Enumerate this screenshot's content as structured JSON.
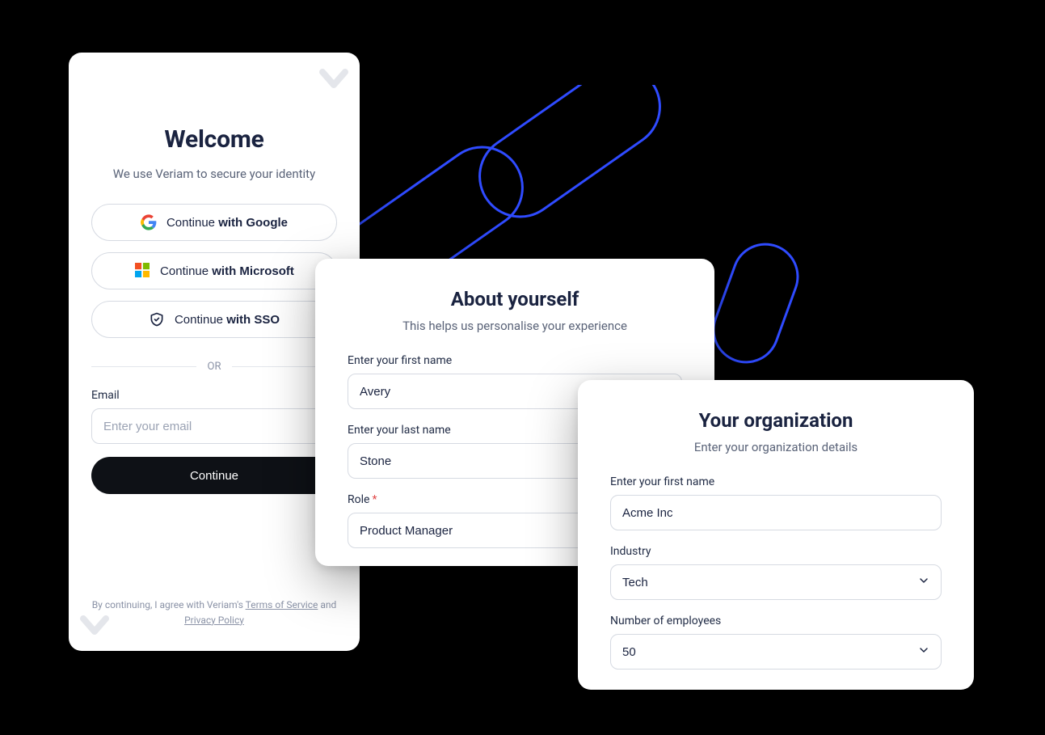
{
  "welcome": {
    "title": "Welcome",
    "subtitle": "We use Veriam to secure your identity",
    "google": {
      "lead": "Continue ",
      "bold": "with Google"
    },
    "microsoft": {
      "lead": "Continue ",
      "bold": "with Microsoft"
    },
    "sso": {
      "lead": "Continue ",
      "bold": "with SSO"
    },
    "divider": "OR",
    "email_label": "Email",
    "email_placeholder": "Enter your email",
    "continue_label": "Continue",
    "footer_prefix": "By continuing, I agree with Veriam's ",
    "tos": "Terms of Service",
    "footer_and": " and ",
    "privacy": "Privacy Policy"
  },
  "about": {
    "title": "About yourself",
    "subtitle": "This helps us personalise your experience",
    "first_name_label": "Enter your first name",
    "first_name_value": "Avery",
    "last_name_label": "Enter your last name",
    "last_name_value": "Stone",
    "role_label": "Role",
    "role_value": "Product Manager"
  },
  "org": {
    "title": "Your organization",
    "subtitle": "Enter your organization details",
    "org_name_label": "Enter your first name",
    "org_name_value": "Acme Inc",
    "industry_label": "Industry",
    "industry_value": "Tech",
    "employees_label": "Number of employees",
    "employees_value": "50"
  }
}
